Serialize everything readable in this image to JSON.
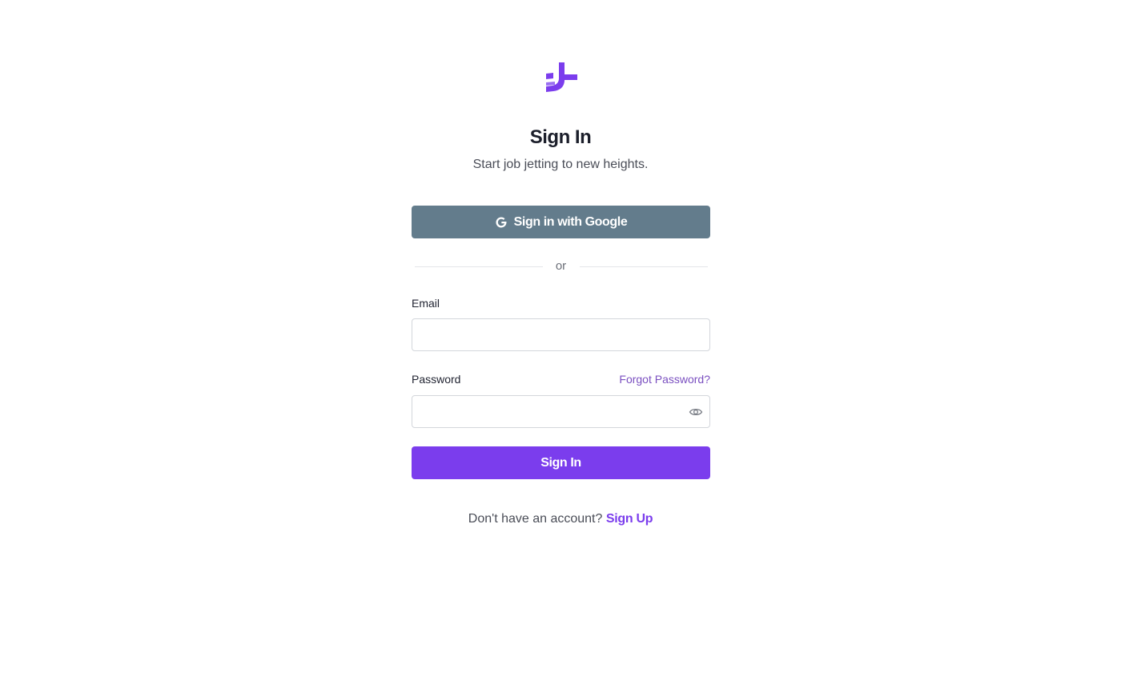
{
  "brand": {
    "logo_icon": "jetting-plus-logo-icon",
    "accent_color": "#7b3ded"
  },
  "header": {
    "title": "Sign In",
    "subtitle": "Start job jetting to new heights."
  },
  "google_button": {
    "icon": "google-g-icon",
    "label": "Sign in with Google",
    "color": "#637c8c"
  },
  "divider": {
    "text": "or"
  },
  "email": {
    "label": "Email",
    "value": "",
    "placeholder": ""
  },
  "password": {
    "label": "Password",
    "forgot_label": "Forgot Password?",
    "value": "",
    "placeholder": "",
    "toggle_icon": "eye-icon"
  },
  "submit": {
    "label": "Sign In"
  },
  "footer": {
    "prompt": "Don't have an account?",
    "signup_label": "Sign Up"
  }
}
